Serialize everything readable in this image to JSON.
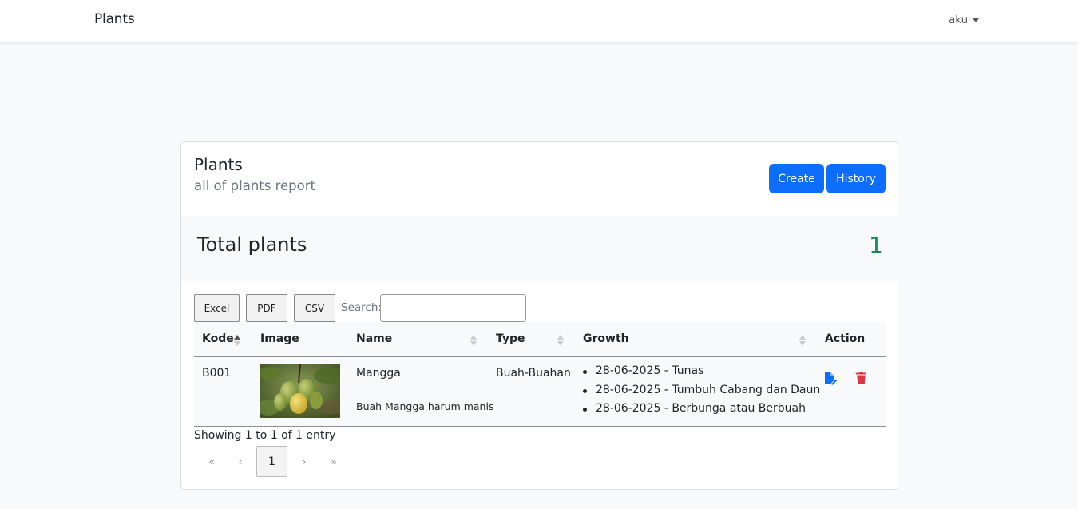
{
  "navbar": {
    "brand": "Plants",
    "user": "aku"
  },
  "card": {
    "title": "Plants",
    "subtitle": "all of plants report",
    "buttons": {
      "create": "Create",
      "history": "History"
    }
  },
  "total": {
    "label": "Total plants",
    "value": "1",
    "value_color": "#198754"
  },
  "toolbar": {
    "excel": "Excel",
    "pdf": "PDF",
    "csv": "CSV",
    "search_label": "Search:",
    "search_value": ""
  },
  "table": {
    "columns": [
      "Kode",
      "Image",
      "Name",
      "Type",
      "Growth",
      "Action"
    ],
    "rows": [
      {
        "kode": "B001",
        "image_icon": "mango-photo",
        "name": "Mangga",
        "description": "Buah Mangga harum manis",
        "type": "Buah-Buahan",
        "growth": [
          "28-06-2025 - Tunas",
          "28-06-2025 - Tumbuh Cabang dan Daun",
          "28-06-2025 - Berbunga atau Berbuah"
        ],
        "actions": [
          "edit-document-icon",
          "trash-icon"
        ]
      }
    ]
  },
  "footer": {
    "showing": "Showing 1 to 1 of 1 entry"
  },
  "pagination": {
    "first": "«",
    "prev": "‹",
    "current": "1",
    "next": "›",
    "last": "»"
  },
  "colors": {
    "primary": "#0d6efd",
    "danger": "#dc3545",
    "success": "#198754"
  }
}
